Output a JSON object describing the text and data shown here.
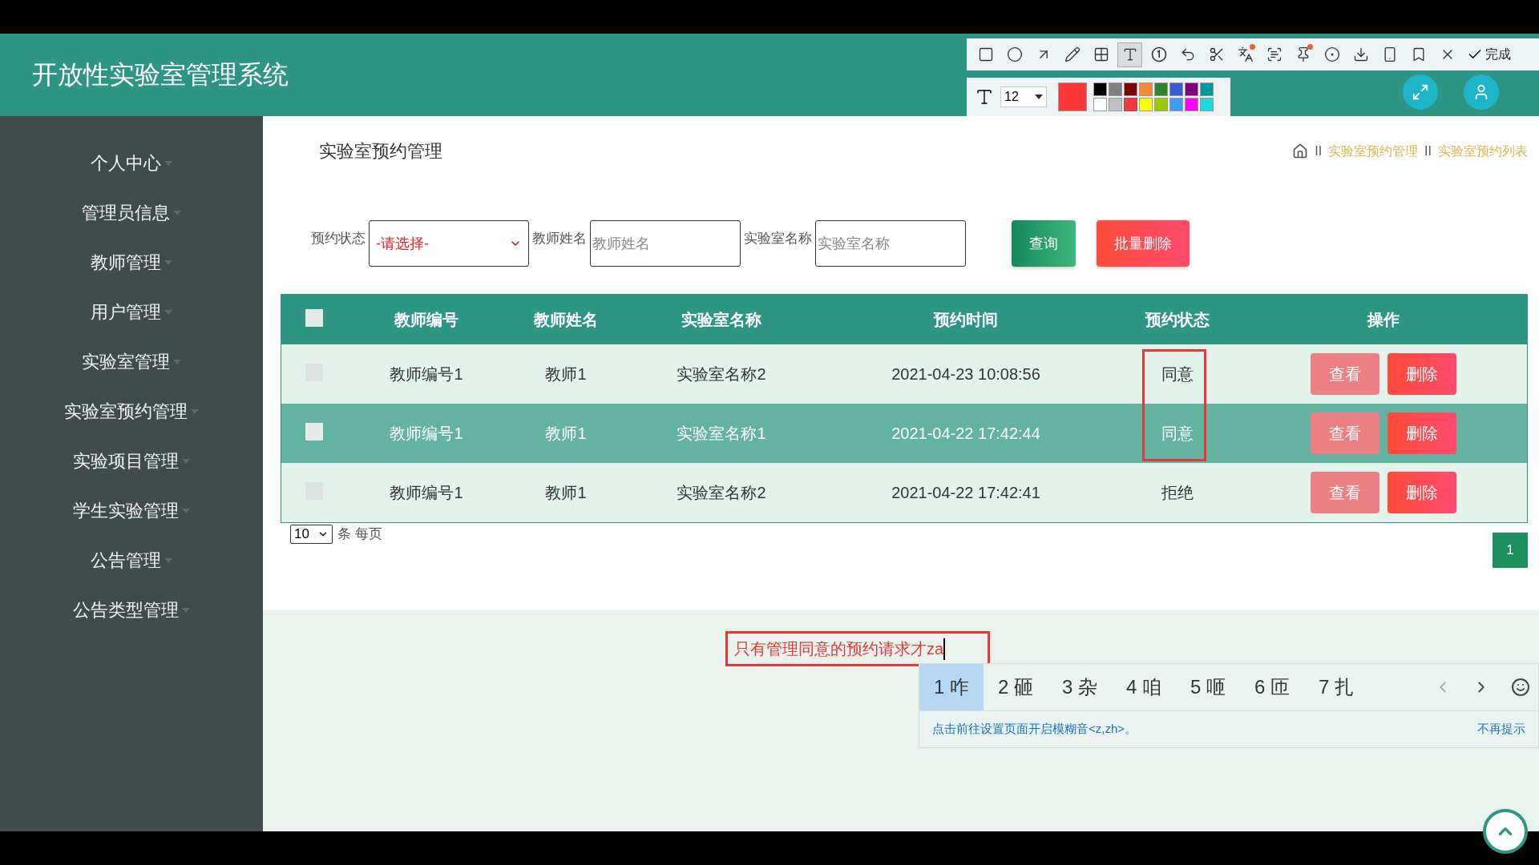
{
  "header": {
    "title": "开放性实验室管理系统"
  },
  "capture_toolbar": {
    "tools": [
      {
        "kind": "rectangle",
        "selected": false,
        "badge": false
      },
      {
        "kind": "ellipse",
        "selected": false,
        "badge": false
      },
      {
        "kind": "arrow",
        "selected": false,
        "badge": false
      },
      {
        "kind": "pencil",
        "selected": false,
        "badge": false
      },
      {
        "kind": "mosaic",
        "selected": false,
        "badge": false
      },
      {
        "kind": "text",
        "selected": true,
        "badge": false
      },
      {
        "kind": "number",
        "selected": false,
        "badge": false
      },
      {
        "kind": "undo",
        "selected": false,
        "badge": false
      },
      {
        "kind": "cut",
        "selected": false,
        "badge": false
      },
      {
        "kind": "translate",
        "selected": false,
        "badge": true
      },
      {
        "kind": "ocr",
        "selected": false,
        "badge": false
      },
      {
        "kind": "pin",
        "selected": false,
        "badge": true
      },
      {
        "kind": "record",
        "selected": false,
        "badge": false
      },
      {
        "kind": "download",
        "selected": false,
        "badge": false
      },
      {
        "kind": "phone",
        "selected": false,
        "badge": false
      },
      {
        "kind": "bookmark",
        "selected": false,
        "badge": false
      },
      {
        "kind": "close",
        "selected": false,
        "badge": false
      }
    ],
    "done_label": "完成",
    "font_size": "12",
    "palette": [
      {
        "color": "#000000"
      },
      {
        "color": "#808080"
      },
      {
        "color": "#800000"
      },
      {
        "color": "#f7883a"
      },
      {
        "color": "#308430"
      },
      {
        "color": "#385ad3"
      },
      {
        "color": "#800080"
      },
      {
        "color": "#009999"
      },
      {
        "color": "#ffffff"
      },
      {
        "color": "#c0c0c0"
      },
      {
        "color": "#fb3838",
        "current": true
      },
      {
        "color": "#ffff00"
      },
      {
        "color": "#99cc00"
      },
      {
        "color": "#3d9cf5"
      },
      {
        "color": "#ff00ff"
      },
      {
        "color": "#1cd9e0"
      }
    ]
  },
  "sidebar": {
    "items": [
      {
        "label": "个人中心"
      },
      {
        "label": "管理员信息"
      },
      {
        "label": "教师管理"
      },
      {
        "label": "用户管理"
      },
      {
        "label": "实验室管理"
      },
      {
        "label": "实验室预约管理"
      },
      {
        "label": "实验项目管理"
      },
      {
        "label": "学生实验管理"
      },
      {
        "label": "公告管理"
      },
      {
        "label": "公告类型管理"
      }
    ]
  },
  "page": {
    "title": "实验室预约管理",
    "breadcrumb": [
      {
        "separator": "II",
        "label": "实验室预约管理"
      },
      {
        "separator": "II",
        "label": "实验室预约列表"
      }
    ]
  },
  "filters": {
    "status_label": "预约状态",
    "status_value": "-请选择-",
    "teacher_label": "教师姓名",
    "teacher_placeholder": "教师姓名",
    "lab_label": "实验室名称",
    "lab_placeholder": "实验室名称",
    "search_button": "查询",
    "batch_delete_button": "批量删除"
  },
  "table": {
    "header_checked": false,
    "columns": [
      "教师编号",
      "教师姓名",
      "实验室名称",
      "预约时间",
      "预约状态",
      "操作"
    ],
    "rows": [
      {
        "selected": false,
        "checked": false,
        "cells": [
          "教师编号1",
          "教师1",
          "实验室名称2",
          "2021-04-23 10:08:56",
          "同意"
        ],
        "view_button": "查看",
        "delete_button": "删除"
      },
      {
        "selected": true,
        "checked": false,
        "cells": [
          "教师编号1",
          "教师1",
          "实验室名称1",
          "2021-04-22 17:42:44",
          "同意"
        ],
        "view_button": "查看",
        "delete_button": "删除"
      },
      {
        "selected": false,
        "checked": false,
        "cells": [
          "教师编号1",
          "教师1",
          "实验室名称2",
          "2021-04-22 17:42:41",
          "拒绝"
        ],
        "view_button": "查看",
        "delete_button": "删除"
      }
    ]
  },
  "pagination": {
    "page_size": "10",
    "page_size_label": "条 每页",
    "pages": [
      {
        "label": "1",
        "selected": true
      }
    ]
  },
  "annotation": {
    "text": "只有管理同意的预约请求才za"
  },
  "ime": {
    "candidates": [
      {
        "label": "1 咋",
        "selected": true
      },
      {
        "label": "2 砸",
        "selected": false
      },
      {
        "label": "3 杂",
        "selected": false
      },
      {
        "label": "4 咱",
        "selected": false
      },
      {
        "label": "5 咂",
        "selected": false
      },
      {
        "label": "6 匝",
        "selected": false
      },
      {
        "label": "7 扎",
        "selected": false
      }
    ],
    "hint": "点击前往设置页面开启模糊音<z,zh>。",
    "dismiss": "不再提示"
  }
}
